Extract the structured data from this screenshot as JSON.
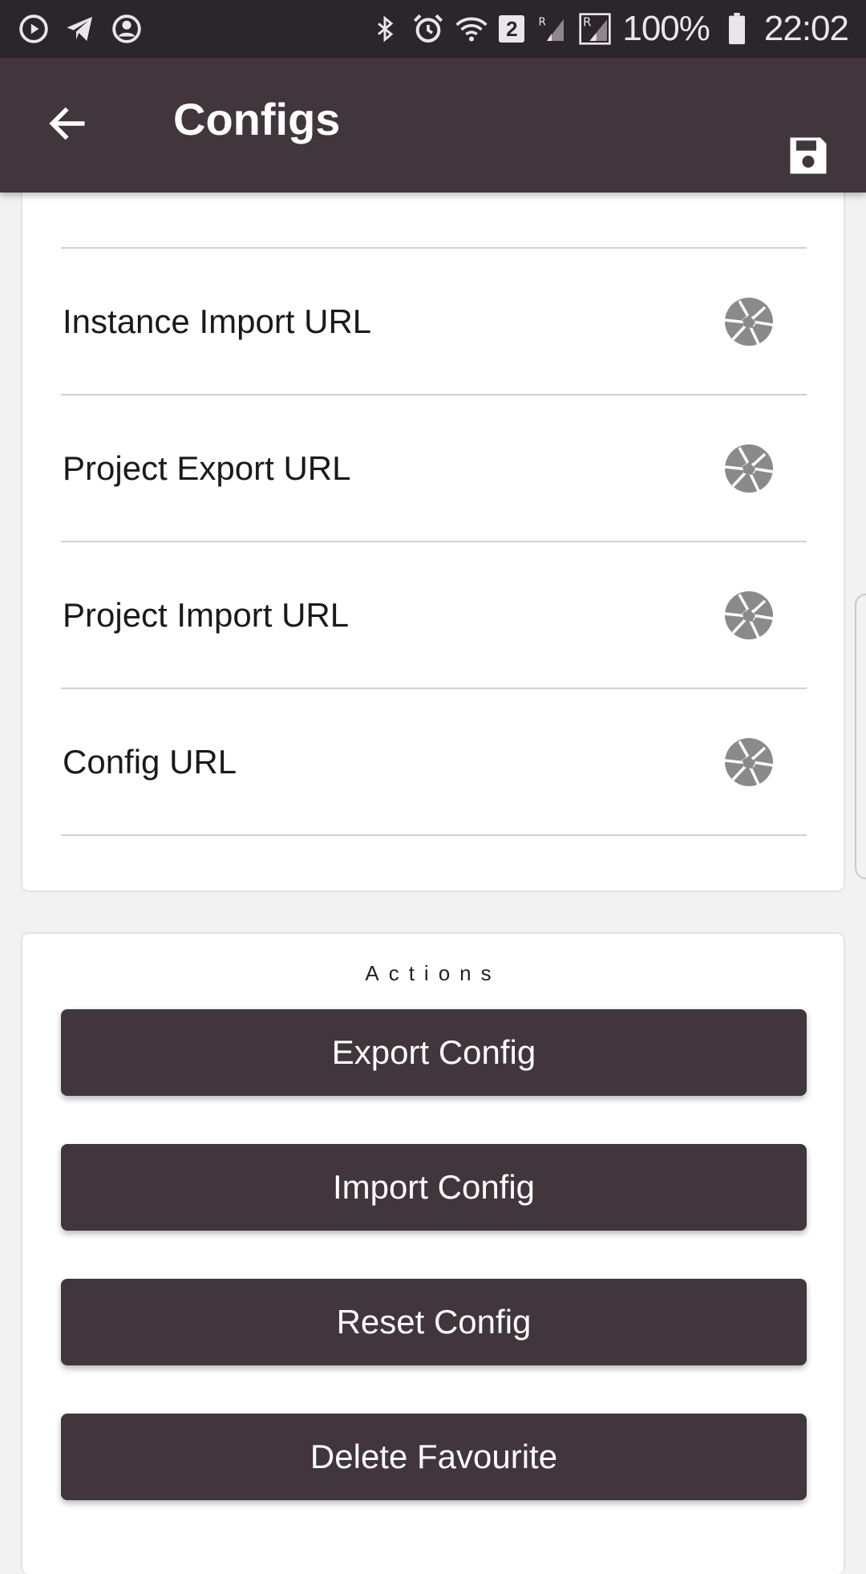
{
  "status_bar": {
    "battery": "100%",
    "time": "22:02",
    "notification_count": "2",
    "icons_left": [
      "play-circle-icon",
      "telegram-icon",
      "account-circle-icon"
    ],
    "icons_right": [
      "bluetooth-icon",
      "alarm-icon",
      "wifi-icon",
      "signal-icon",
      "signal-roaming-icon",
      "battery-icon"
    ]
  },
  "app_bar": {
    "title": "Configs",
    "back_icon": "arrow-left-icon",
    "save_icon": "floppy-disk-icon"
  },
  "urls": {
    "items": [
      {
        "label": "Instance Import URL",
        "icon": "camera-aperture-icon"
      },
      {
        "label": "Project Export URL",
        "icon": "camera-aperture-icon"
      },
      {
        "label": "Project Import URL",
        "icon": "camera-aperture-icon"
      },
      {
        "label": "Config URL",
        "icon": "camera-aperture-icon"
      }
    ]
  },
  "actions": {
    "title": "Actions",
    "buttons": [
      "Export Config",
      "Import Config",
      "Reset Config",
      "Delete Favourite"
    ]
  },
  "colors": {
    "app_bar": "#40363c",
    "status_bar": "#2b262a",
    "button": "#40363c",
    "icon_gray": "#8a8a8a"
  }
}
